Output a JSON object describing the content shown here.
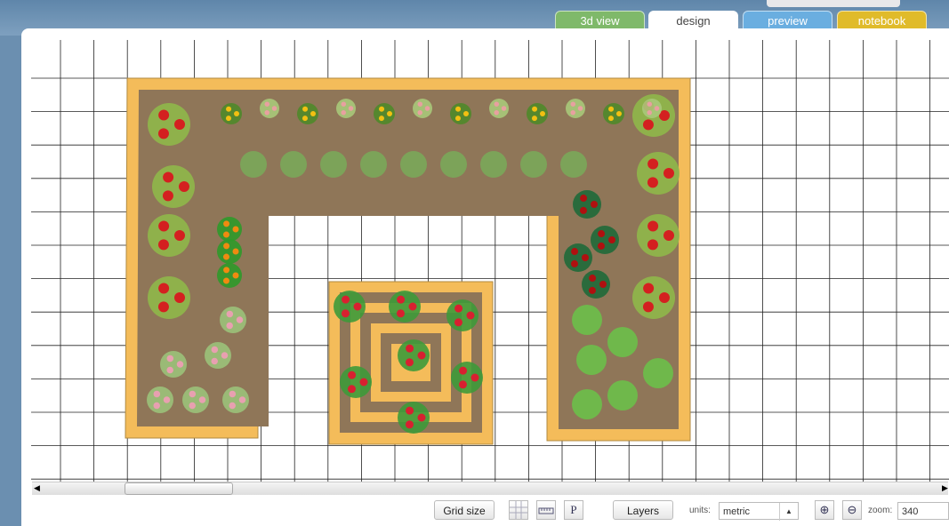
{
  "tabs": [
    {
      "label": "3d view",
      "color": "#7fb96a"
    },
    {
      "label": "design",
      "color": "#ffffff"
    },
    {
      "label": "preview",
      "color": "#6aaee0"
    },
    {
      "label": "notebook",
      "color": "#e0bb2a"
    }
  ],
  "active_tab": "design",
  "toolbar": {
    "grid_size": "Grid size",
    "grid_icon": "grid-icon",
    "ruler_icon": "ruler-icon",
    "p_label": "P",
    "layers": "Layers",
    "units_label": "units:",
    "units_value": "metric",
    "zoom_label": "zoom:",
    "zoom_value": "340"
  },
  "colors": {
    "bed_border": "#f4bc5a",
    "soil": "#8f7658",
    "grid": "#222222"
  }
}
